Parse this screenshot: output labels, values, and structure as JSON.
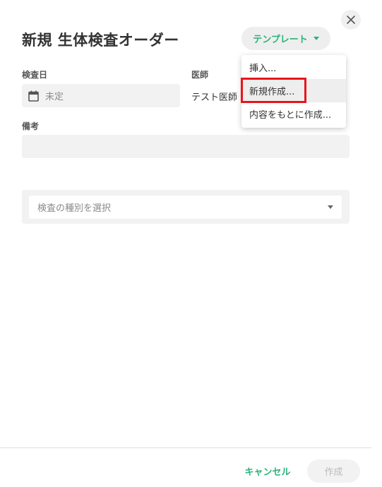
{
  "dialog": {
    "title": "新規 生体検査オーダー",
    "close_icon": "close-icon"
  },
  "template_button": {
    "label": "テンプレート",
    "icon": "caret-down-icon",
    "accent_color": "#2ab27b"
  },
  "template_menu": {
    "items": [
      {
        "label": "挿入..."
      },
      {
        "label": "新規作成..."
      },
      {
        "label": "内容をもとに作成..."
      }
    ],
    "highlighted_item": "新規作成...",
    "highlight_color": "#e8151d"
  },
  "fields": {
    "exam_date": {
      "label": "検査日",
      "value": "未定",
      "icon": "calendar-icon"
    },
    "doctor": {
      "label": "医師",
      "value": "テスト医師"
    },
    "notes": {
      "label": "備考",
      "value": ""
    },
    "exam_type": {
      "placeholder": "検査の種別を選択",
      "icon": "caret-down-icon"
    }
  },
  "footer": {
    "cancel_label": "キャンセル",
    "create_label": "作成",
    "create_disabled": true
  }
}
